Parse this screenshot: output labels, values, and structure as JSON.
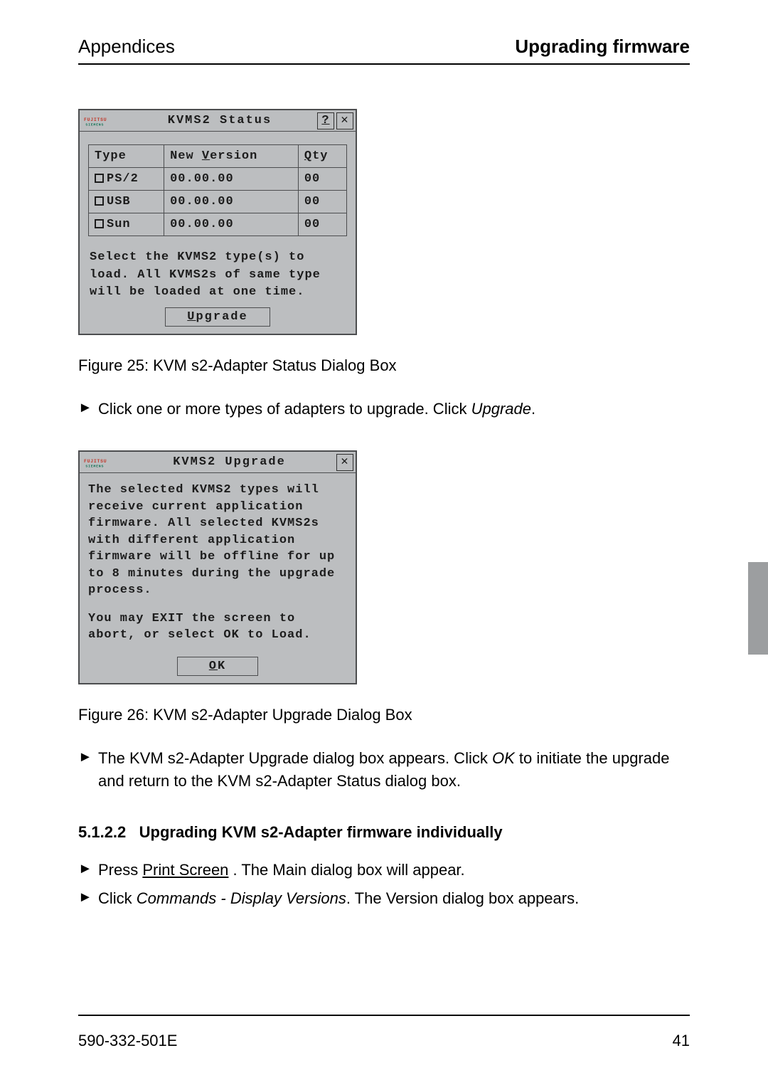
{
  "header": {
    "left": "Appendices",
    "right": "Upgrading firmware"
  },
  "dialog1": {
    "title": "KVMS2 Status",
    "help_glyph": "?",
    "close_glyph": "✕",
    "col_type": "Type",
    "col_ver_prefix": "New ",
    "col_ver_ul": "V",
    "col_ver_rest": "ersion",
    "col_qty_ul": "Q",
    "col_qty_rest": "ty",
    "row1_type_ul": "P",
    "row1_type_rest": "S/2",
    "row1_ver": "00.00.00",
    "row1_qty": "00",
    "row2_type_ul": "U",
    "row2_type_rest": "SB",
    "row2_ver": "00.00.00",
    "row2_qty": "00",
    "row3_type_ul": "S",
    "row3_type_rest": "un",
    "row3_ver": "00.00.00",
    "row3_qty": "00",
    "hint": "Select the KVMS2 type(s) to load. All KVMS2s of same type will be loaded at one time.",
    "btn_ul": "U",
    "btn_rest": "pgrade"
  },
  "caption1": "Figure 25: KVM s2-Adapter Status Dialog Box",
  "step1_pre": "Click one or more types of adapters to upgrade. Click ",
  "step1_ital": "Upgrade",
  "step1_post": ".",
  "dialog2": {
    "title": "KVMS2 Upgrade",
    "close_glyph": "✕",
    "body_l1": "The selected KVMS2 types will receive current application firmware. All selected KVMS2s with different application firmware will be offline for up to 8 minutes during the upgrade process.",
    "body_l2": "You may EXIT the screen to abort, or select OK to Load.",
    "btn_ul": "O",
    "btn_rest": "K"
  },
  "caption2": "Figure 26: KVM s2-Adapter Upgrade Dialog Box",
  "step2_pre": "The KVM s2-Adapter Upgrade dialog box appears. Click ",
  "step2_ital": "OK",
  "step2_post": " to initiate the upgrade and return to the KVM s2-Adapter Status dialog box.",
  "section_num": "5.1.2.2",
  "section_title": "Upgrading KVM s2-Adapter firmware individually",
  "step3_pre": "Press ",
  "step3_ul": "Print Screen",
  "step3_post": " . The Main dialog box will appear.",
  "step4_pre": "Click ",
  "step4_ital": "Commands - Display Versions",
  "step4_post": ". The Version dialog box appears.",
  "footer": {
    "left": "590-332-501E",
    "right": "41"
  }
}
